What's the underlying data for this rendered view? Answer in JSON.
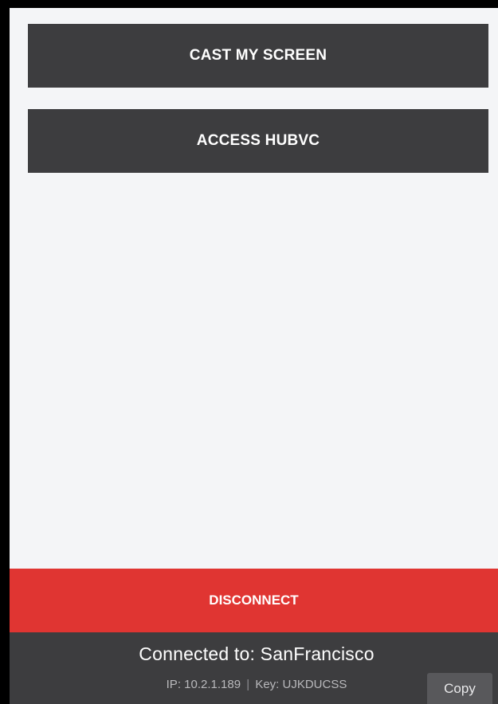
{
  "actions": {
    "cast_label": "CAST MY SCREEN",
    "access_label": "ACCESS HUBVC"
  },
  "disconnect": {
    "label": "DISCONNECT"
  },
  "footer": {
    "connected_text": "Connected to: SanFrancisco",
    "ip_label": "IP:",
    "ip_value": "10.2.1.189",
    "separator": "|",
    "key_label": "Key:",
    "key_value": "UJKDUCSS",
    "copy_label": "Copy"
  },
  "colors": {
    "button_dark": "#3d3d3f",
    "disconnect_red": "#e03532",
    "background": "#f4f5f7"
  }
}
